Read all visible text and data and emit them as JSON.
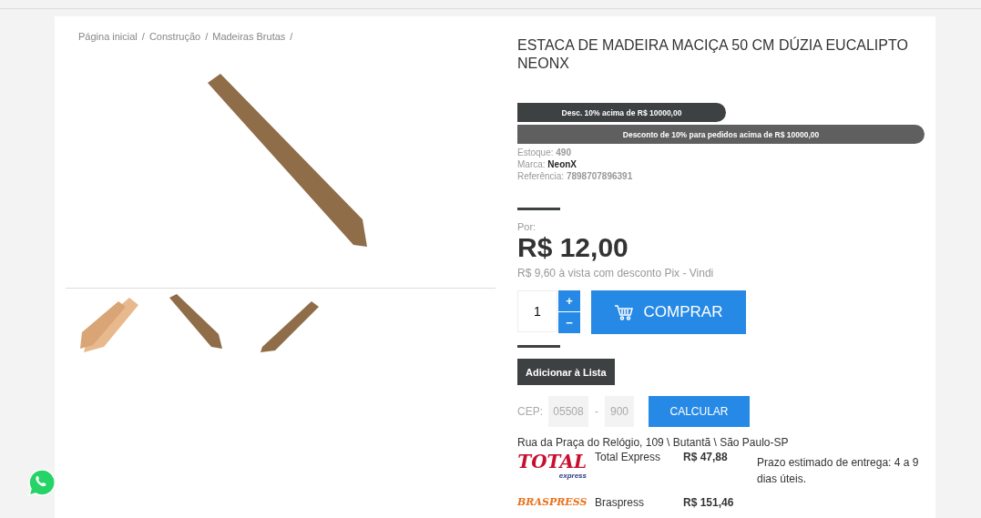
{
  "breadcrumb": [
    "Página inicial",
    "Construção",
    "Madeiras Brutas"
  ],
  "breadcrumb_separator": "/",
  "thumbnails": [
    {
      "kind": "bundle"
    },
    {
      "kind": "down"
    },
    {
      "kind": "up"
    }
  ],
  "product": {
    "title": "ESTACA DE MADEIRA MACIÇA 50 CM DÚZIA EUCALIPTO NEONX",
    "badges": [
      {
        "text": "Desc. 10% acima de R$ 10000,00",
        "kind": "short"
      },
      {
        "text": "Desconto de 10% para pedidos acima de R$ 10000,00",
        "kind": "full"
      }
    ],
    "specs": [
      {
        "label": "Estoque:",
        "value": "490",
        "kind": "muted"
      },
      {
        "label": "Marca:",
        "value": "NeonX",
        "kind": "strong"
      },
      {
        "label": "Referência:",
        "value": "7898707896391",
        "kind": "muted"
      }
    ],
    "price_label": "Por:",
    "price": "R$ 12,00",
    "pix_price": "R$ 9,60",
    "pix_note": "à vista com desconto Pix - Vindi",
    "quantity": "1",
    "increment": "+",
    "decrement": "−",
    "buy_button": "COMPRAR",
    "add_to_list": "Adicionar à Lista"
  },
  "shipping": {
    "label": "CEP:",
    "cep_part_1": "05508",
    "separator": "-",
    "cep_part_2": "900",
    "button": "CALCULAR",
    "address": "Rua da Praça do Relógio, 109 \\ Butantã \\ São Paulo-SP",
    "options": [
      {
        "logo": "TOTAL",
        "logo_sub": "express",
        "kind": "total",
        "carrier": "Total Express",
        "price": "R$ 47,88",
        "estimate": "Prazo estimado de entrega: 4 a 9 dias úteis."
      },
      {
        "logo": "BRASPRESS",
        "kind": "braspress",
        "carrier": "Braspress",
        "price": "R$ 151,46"
      }
    ]
  }
}
